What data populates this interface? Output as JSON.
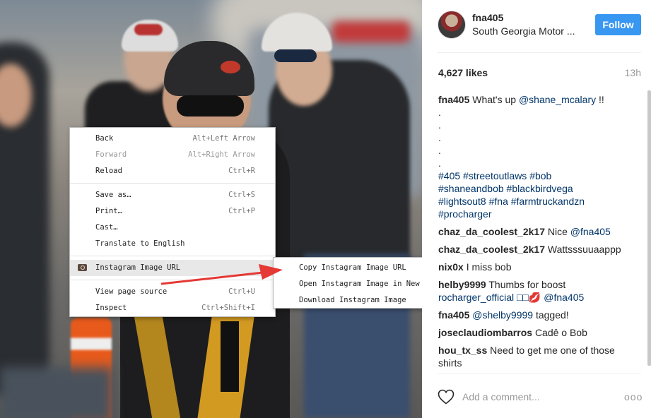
{
  "post": {
    "username": "fna405",
    "location": "South Georgia Motor ...",
    "follow_label": "Follow",
    "likes": "4,627 likes",
    "time": "13h",
    "caption": {
      "username": "fna405",
      "text": "What's up",
      "mention": "@shane_mcalary",
      "suffix": "!!",
      "dots": [
        ".",
        ".",
        ".",
        ".",
        "."
      ],
      "tags": [
        "#405 #streetoutlaws #bob",
        "#shaneandbob #blackbirdvega",
        "#lightsout8 #fna #farmtruckandzn",
        "#procharger"
      ]
    },
    "comments": [
      {
        "user": "chaz_da_coolest_2k17",
        "text": "Nice",
        "mention": "@fna405"
      },
      {
        "user": "chaz_da_coolest_2k17",
        "text": "Wattsssuuaappp",
        "mention": ""
      },
      {
        "user": "nix0x",
        "text": "I miss bob",
        "mention": ""
      },
      {
        "user": "helby9999",
        "text": "Thumbs for boost",
        "mention": "rocharger_official □□💋 @fna405"
      },
      {
        "user": "fna405",
        "text": "tagged!",
        "mention": "@shelby9999"
      },
      {
        "user": "joseclaudiombarros",
        "text": "Cadê o Bob",
        "mention": ""
      },
      {
        "user": "hou_tx_ss",
        "text": "Need to get me one of those shirts",
        "mention": ""
      }
    ],
    "add_comment_placeholder": "Add a comment...",
    "more_label": "ooo"
  },
  "context_menu": {
    "items": [
      {
        "label": "Back",
        "shortcut": "Alt+Left Arrow"
      },
      {
        "label": "Forward",
        "shortcut": "Alt+Right Arrow"
      },
      {
        "label": "Reload",
        "shortcut": "Ctrl+R"
      },
      {
        "label": "Save as…",
        "shortcut": "Ctrl+S"
      },
      {
        "label": "Print…",
        "shortcut": "Ctrl+P"
      },
      {
        "label": "Cast…",
        "shortcut": ""
      },
      {
        "label": "Translate to English",
        "shortcut": ""
      },
      {
        "label": "Instagram Image URL",
        "shortcut": ""
      },
      {
        "label": "View page source",
        "shortcut": "Ctrl+U"
      },
      {
        "label": "Inspect",
        "shortcut": "Ctrl+Shift+I"
      }
    ],
    "submenu": [
      "Copy Instagram Image URL",
      "Open Instagram Image in New Tab",
      "Download Instagram Image"
    ]
  },
  "colors": {
    "follow_button": "#3897f0",
    "link": "#003569",
    "annotation_arrow": "#e53935"
  }
}
